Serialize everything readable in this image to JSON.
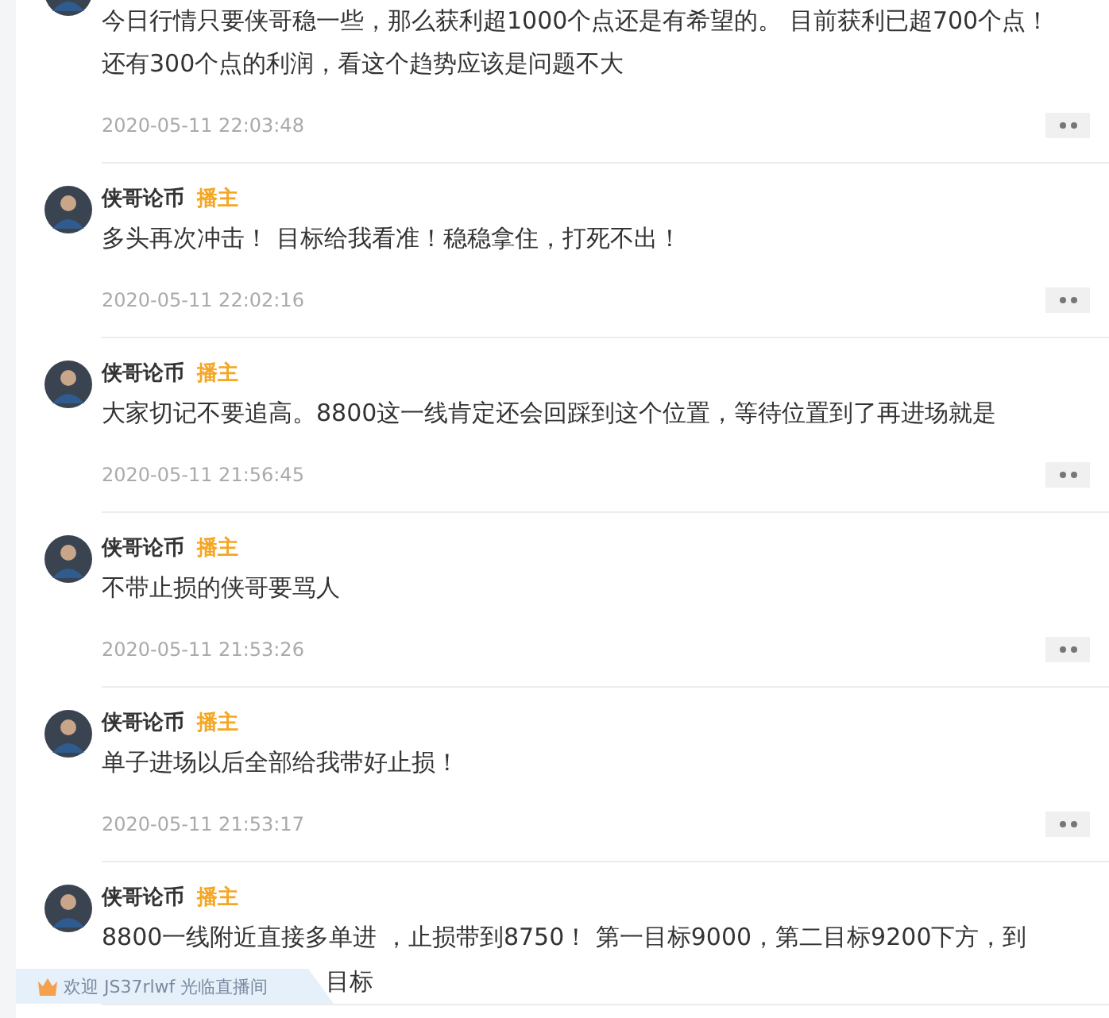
{
  "comments": [
    {
      "text": "今日行情只要侠哥稳一些，那么获利超1000个点还是有希望的。 目前获利已超700个点！还有300个点的利润，看这个趋势应该是问题不大",
      "time": "2020-05-11 22:03:48"
    },
    {
      "author": "侠哥论币",
      "badge": "播主",
      "text": "多头再次冲击！ 目标给我看准！稳稳拿住，打死不出！",
      "time": "2020-05-11 22:02:16"
    },
    {
      "author": "侠哥论币",
      "badge": "播主",
      "text": "大家切记不要追高。8800这一线肯定还会回踩到这个位置，等待位置到了再进场就是",
      "time": "2020-05-11 21:56:45"
    },
    {
      "author": "侠哥论币",
      "badge": "播主",
      "text": "不带止损的侠哥要骂人",
      "time": "2020-05-11 21:53:26"
    },
    {
      "author": "侠哥论币",
      "badge": "播主",
      "text": "单子进场以后全部给我带好止损！",
      "time": "2020-05-11 21:53:17"
    },
    {
      "author": "侠哥论币",
      "badge": "播主",
      "text": "8800一线附近直接多单进 ，止损带到8750！ 第一目标9000，第二目标9200下方，到",
      "text_tail": "目标"
    }
  ],
  "welcome": {
    "prefix": "欢迎",
    "user": "JS37rlwf",
    "suffix": "光临直播间"
  }
}
